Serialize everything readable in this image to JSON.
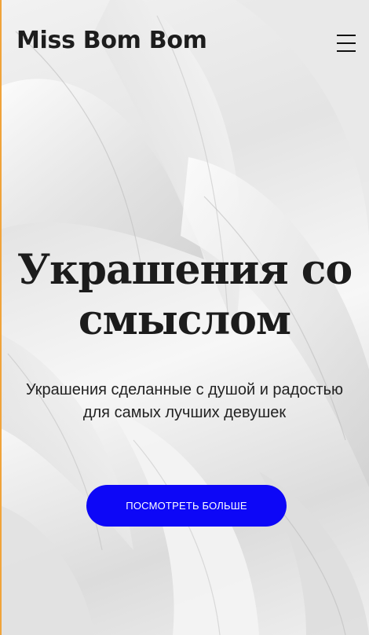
{
  "header": {
    "logo_text": "Miss Bom Bom",
    "menu_icon": "hamburger-menu-icon"
  },
  "hero": {
    "title": "Украшения со смыслом",
    "subtitle": "Украшения сделанные с душой и радостью для самых лучших девушек",
    "cta_label": "ПОСМОТРЕТЬ БОЛЬШЕ",
    "background_image": "white-feathers"
  },
  "colors": {
    "cta_background": "#0d07f7",
    "cta_text": "#ffffff",
    "text_dark": "#1c1c1c",
    "edge_accent": "#f0a33a"
  }
}
